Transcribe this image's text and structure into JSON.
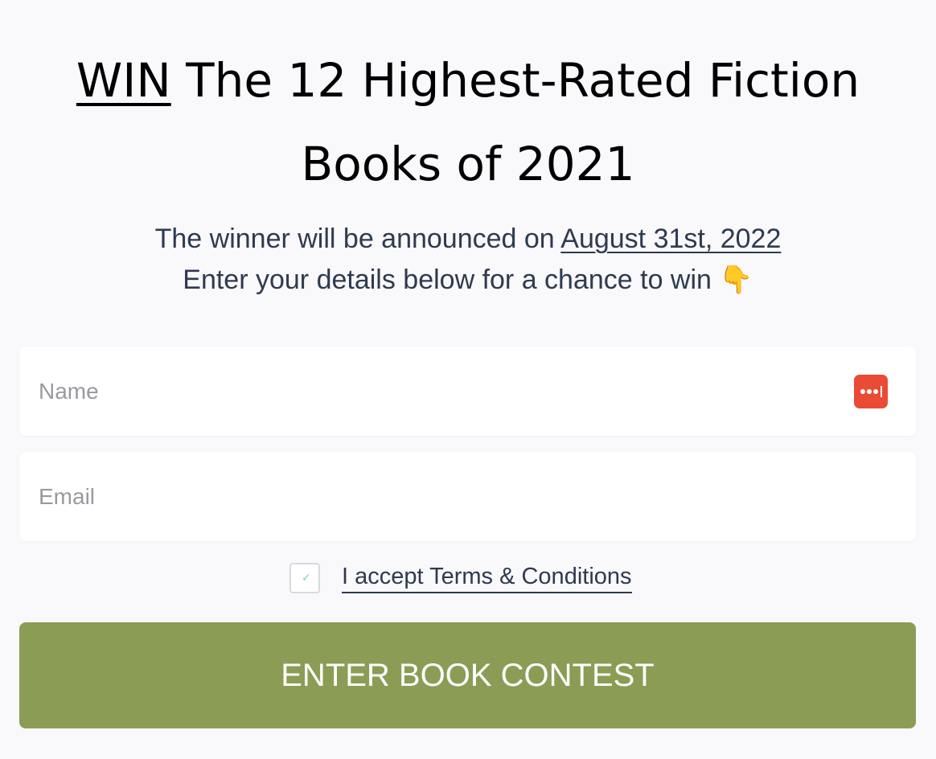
{
  "headline": {
    "win": "WIN",
    "rest_line1": " The 12 Highest-Rated Fiction",
    "line2": "Books of 2021"
  },
  "subtext": {
    "line1_prefix": "The winner will be announced on ",
    "date": "August 31st, 2022",
    "line2": "Enter your details below for a chance to win 👇"
  },
  "form": {
    "name_placeholder": "Name",
    "email_placeholder": "Email",
    "name_value": "",
    "email_value": "",
    "terms_label": "I accept Terms & Conditions",
    "terms_checked": false,
    "submit_label": "ENTER BOOK CONTEST",
    "password_manager_icon": "password-manager-icon"
  },
  "colors": {
    "background": "#f9f8fb",
    "button": "#8b9c55",
    "button_text": "#ffffff",
    "subtext": "#2e3a4f",
    "password_manager_icon": "#e94b35"
  }
}
